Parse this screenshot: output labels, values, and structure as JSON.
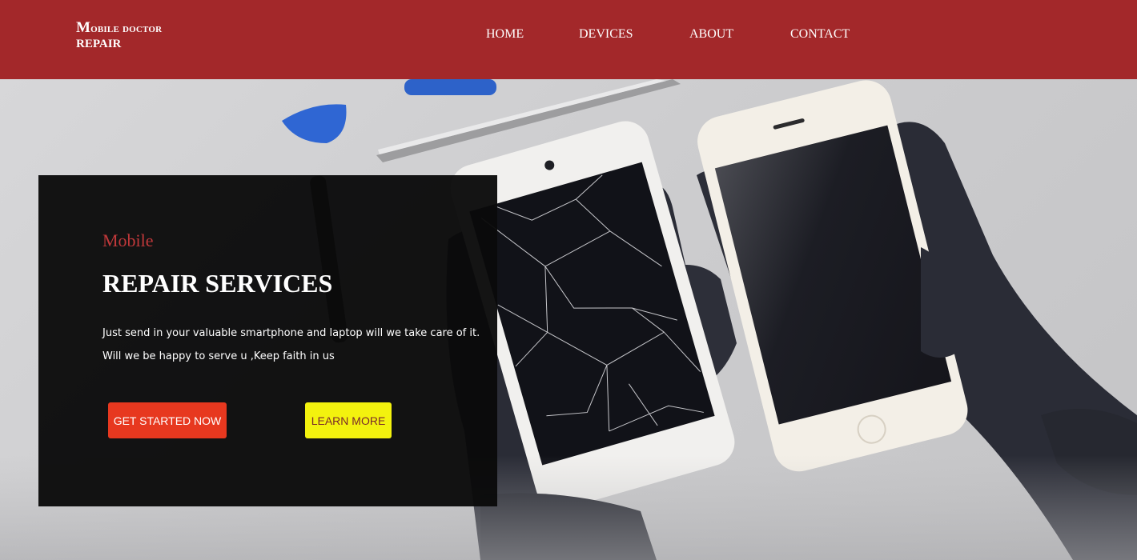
{
  "brand": {
    "line1_first": "M",
    "line1_rest": "obile doctor",
    "line2": "REPAIR"
  },
  "nav": {
    "items": [
      "HOME",
      "DEVICES",
      "ABOUT",
      "CONTACT"
    ]
  },
  "hero": {
    "kicker": "Mobile",
    "title": "REPAIR SERVICES",
    "description_line1": "Just send in your valuable smartphone and laptop will we take care of it.",
    "description_line2": "Will we be happy to serve u ,Keep faith in us",
    "primary_button": "GET STARTED NOW",
    "secondary_button": "LEARN MORE"
  },
  "colors": {
    "header": "#a3282a",
    "card": "#0a0a0a",
    "kicker": "#c0383a",
    "primary": "#e7381f",
    "secondary": "#f3f20e"
  }
}
